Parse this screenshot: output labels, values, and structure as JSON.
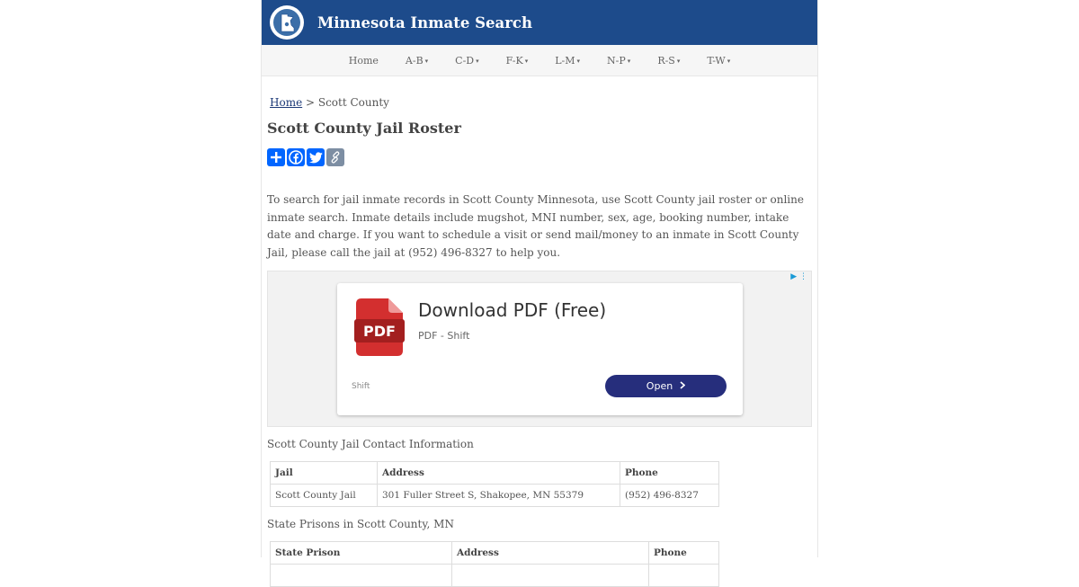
{
  "header": {
    "title": "Minnesota Inmate Search"
  },
  "nav": {
    "items": [
      {
        "label": "Home",
        "dropdown": false
      },
      {
        "label": "A-B",
        "dropdown": true
      },
      {
        "label": "C-D",
        "dropdown": true
      },
      {
        "label": "F-K",
        "dropdown": true
      },
      {
        "label": "L-M",
        "dropdown": true
      },
      {
        "label": "N-P",
        "dropdown": true
      },
      {
        "label": "R-S",
        "dropdown": true
      },
      {
        "label": "T-W",
        "dropdown": true
      }
    ],
    "caret": "▾"
  },
  "breadcrumb": {
    "home": "Home",
    "separator": " > ",
    "current": "Scott County"
  },
  "page": {
    "title": "Scott County Jail Roster",
    "intro": "To search for jail inmate records in Scott County Minnesota, use Scott County jail roster or online inmate search. Inmate details include mugshot, MNI number, sex, age, booking number, intake date and charge. If you want to schedule a visit or send mail/money to an inmate in Scott County Jail, please call the jail at (952) 496-8327 to help you."
  },
  "share": {
    "icons": [
      "share-plus-icon",
      "facebook-icon",
      "twitter-icon",
      "copy-link-icon"
    ],
    "color": "#0166ff"
  },
  "ad": {
    "headline": "Download PDF (Free)",
    "subline": "PDF - Shift",
    "brand": "Shift",
    "cta": "Open",
    "pdf_label": "PDF"
  },
  "contact": {
    "title": "Scott County Jail Contact Information",
    "headers": [
      "Jail",
      "Address",
      "Phone"
    ],
    "rows": [
      [
        "Scott County Jail",
        "301 Fuller Street S, Shakopee, MN 55379",
        "(952) 496-8327"
      ]
    ]
  },
  "prisons": {
    "title": "State Prisons in Scott County, MN",
    "headers": [
      "State Prison",
      "Address",
      "Phone"
    ]
  },
  "colors": {
    "header_bg": "#1d4b8b",
    "ad_button": "#262e7c",
    "pdf_red": "#d32f2f"
  }
}
